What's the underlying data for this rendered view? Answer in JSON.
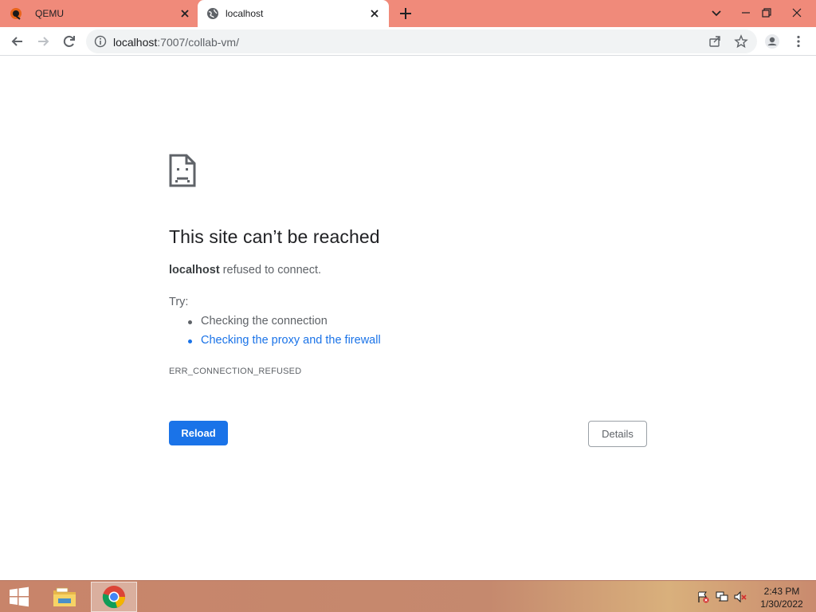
{
  "browser": {
    "tabs": [
      {
        "title": "QEMU",
        "favicon": "qemu-icon",
        "active": false
      },
      {
        "title": "localhost",
        "favicon": "globe-icon",
        "active": true
      }
    ],
    "url_host": "localhost",
    "url_rest": ":7007/collab-vm/",
    "colors": {
      "tabstrip": "#f08a7a",
      "accent": "#1a73e8"
    }
  },
  "error": {
    "heading": "This site can’t be reached",
    "host": "localhost",
    "message": " refused to connect.",
    "try_label": "Try:",
    "suggestions": [
      "Checking the connection",
      "Checking the proxy and the firewall"
    ],
    "code": "ERR_CONNECTION_REFUSED",
    "reload_label": "Reload",
    "details_label": "Details"
  },
  "taskbar": {
    "items": [
      "start-icon",
      "file-explorer-icon",
      "chrome-icon"
    ],
    "tray": [
      "action-center-flag-icon",
      "network-icon",
      "volume-muted-icon"
    ],
    "time": "2:43 PM",
    "date": "1/30/2022"
  }
}
